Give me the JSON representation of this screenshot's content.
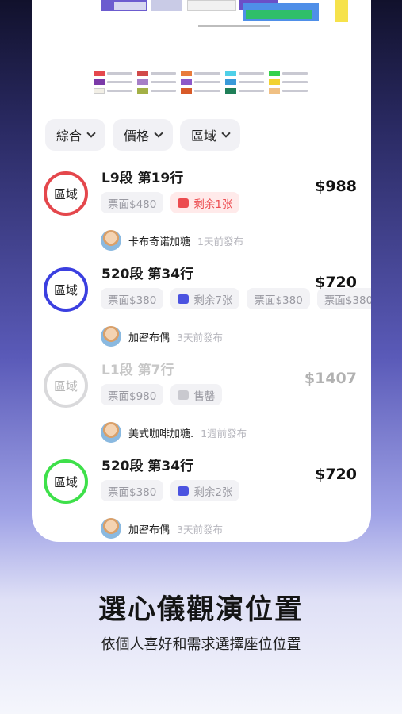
{
  "filters": [
    {
      "label": "綜合"
    },
    {
      "label": "價格"
    },
    {
      "label": "區域"
    }
  ],
  "listings": [
    {
      "ring_label": "區域",
      "ring_color": "#e4474c",
      "title": "L9段 第19行",
      "price": "$988",
      "tags": [
        {
          "text": "票面$480",
          "style": "plain"
        },
        {
          "text": "剩余1张",
          "style": "red",
          "icon": "ticket-icon"
        }
      ],
      "seller": "卡布奇诺加糖",
      "posted": "1天前發布",
      "sold": false
    },
    {
      "ring_label": "區域",
      "ring_color": "#3b3fe0",
      "title": "520段 第34行",
      "price": "$720",
      "tags": [
        {
          "text": "票面$380",
          "style": "plain"
        },
        {
          "text": "剩余7张",
          "style": "blue",
          "icon": "ticket-icon"
        },
        {
          "text": "票面$380",
          "style": "plain"
        },
        {
          "text": "票面$380",
          "style": "plain"
        }
      ],
      "seller": "加密布偶",
      "posted": "3天前發布",
      "sold": false
    },
    {
      "ring_label": "區域",
      "ring_color": "#b9b9be",
      "title": "L1段 第7行",
      "price": "$1407",
      "tags": [
        {
          "text": "票面$980",
          "style": "plain"
        },
        {
          "text": "售罄",
          "style": "gray",
          "icon": "ticket-icon"
        }
      ],
      "seller": "美式咖啡加糖.",
      "posted": "1週前發布",
      "sold": true
    },
    {
      "ring_label": "區域",
      "ring_color": "#3ee04a",
      "title": "520段 第34行",
      "price": "$720",
      "tags": [
        {
          "text": "票面$380",
          "style": "plain"
        },
        {
          "text": "剩余2张",
          "style": "blue",
          "icon": "ticket-icon"
        }
      ],
      "seller": "加密布偶",
      "posted": "3天前發布",
      "sold": false
    }
  ],
  "footer": {
    "headline": "選心儀觀演位置",
    "subline": "依個人喜好和需求選擇座位位置"
  },
  "colors": {
    "accent_blue": "#4b53e0",
    "accent_red": "#ec4b4f"
  }
}
